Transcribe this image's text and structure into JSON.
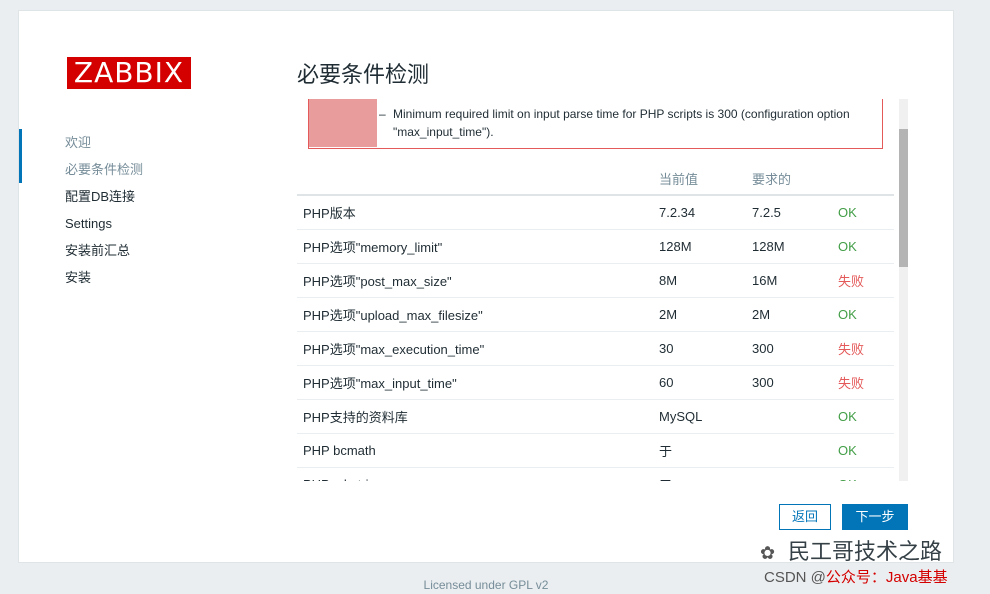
{
  "logo": "ZABBIX",
  "steps": [
    "欢迎",
    "必要条件检测",
    "配置DB连接",
    "Settings",
    "安装前汇总",
    "安装"
  ],
  "title": "必要条件检测",
  "message": {
    "dash": "–",
    "text": "Minimum required limit on input parse time for PHP scripts is 300 (configuration option \"max_input_time\")."
  },
  "table": {
    "headers": [
      "",
      "当前值",
      "要求的",
      ""
    ],
    "rows": [
      {
        "name": "PHP版本",
        "current": "7.2.34",
        "required": "7.2.5",
        "status": "OK",
        "ok": true
      },
      {
        "name": "PHP选项\"memory_limit\"",
        "current": "128M",
        "required": "128M",
        "status": "OK",
        "ok": true
      },
      {
        "name": "PHP选项\"post_max_size\"",
        "current": "8M",
        "required": "16M",
        "status": "失败",
        "ok": false
      },
      {
        "name": "PHP选项\"upload_max_filesize\"",
        "current": "2M",
        "required": "2M",
        "status": "OK",
        "ok": true
      },
      {
        "name": "PHP选项\"max_execution_time\"",
        "current": "30",
        "required": "300",
        "status": "失败",
        "ok": false
      },
      {
        "name": "PHP选项\"max_input_time\"",
        "current": "60",
        "required": "300",
        "status": "失败",
        "ok": false
      },
      {
        "name": "PHP支持的资料库",
        "current": "MySQL",
        "required": "",
        "status": "OK",
        "ok": true
      },
      {
        "name": "PHP bcmath",
        "current": "于",
        "required": "",
        "status": "OK",
        "ok": true
      },
      {
        "name": "PHP mbstring",
        "current": "于",
        "required": "",
        "status": "OK",
        "ok": true
      }
    ]
  },
  "buttons": {
    "back": "返回",
    "next": "下一步"
  },
  "footer": "Licensed under GPL v2",
  "watermark": {
    "line1": "民工哥技术之路",
    "line2_prefix": "CSDN @",
    "line2_red": "公众号：Java基基"
  },
  "colors": {
    "accent": "#0275b8",
    "ok": "#429e47",
    "fail": "#e45959",
    "brand": "#d40000"
  }
}
